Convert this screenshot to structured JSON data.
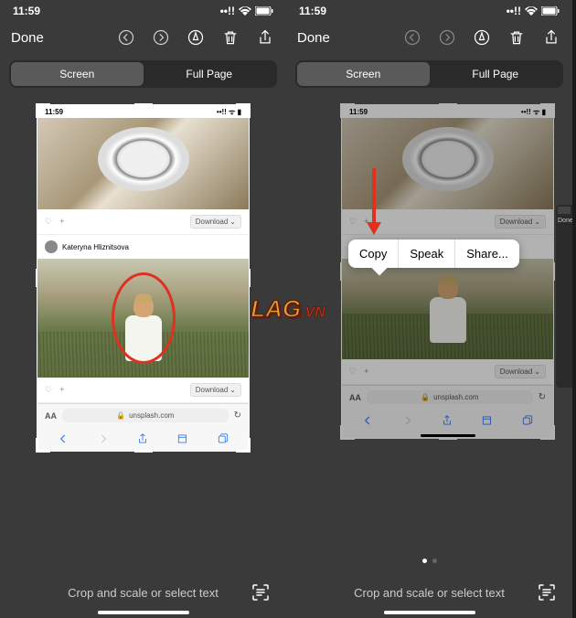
{
  "status": {
    "time": "11:59",
    "signal": "••!!",
    "wifi": "wifi",
    "battery": "battery"
  },
  "header": {
    "done": "Done",
    "icons": [
      "undo",
      "redo",
      "markup",
      "trash",
      "share"
    ]
  },
  "tabs": {
    "screen": "Screen",
    "full_page": "Full Page"
  },
  "screenshot": {
    "status_time": "11:59",
    "download": "Download",
    "author": "Kateryna Hliznitsova",
    "url": "unsplash.com",
    "aa": "AA",
    "lock": "🔒"
  },
  "context_menu": {
    "copy": "Copy",
    "speak": "Speak",
    "share": "Share..."
  },
  "footer": {
    "text": "Crop and scale or select text"
  },
  "side_peek": {
    "done": "Done"
  },
  "watermark": {
    "main": "LAG",
    "suffix": ".VN"
  },
  "colors": {
    "markup_red": "#e03020",
    "accent_blue": "#3478f6"
  }
}
